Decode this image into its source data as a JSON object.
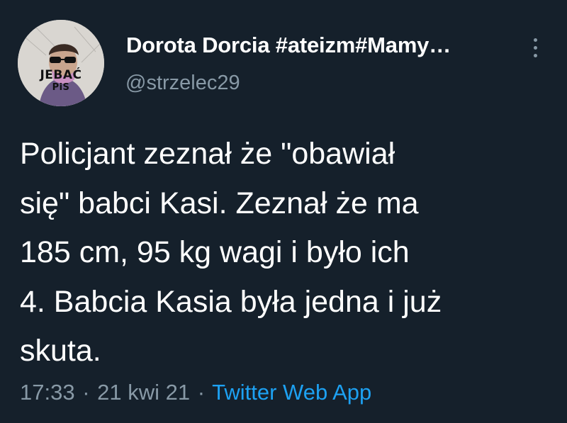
{
  "tweet": {
    "display_name": "Dorota Dorcia #ateizm#Mamy…",
    "handle": "@strzelec29",
    "avatar": {
      "text_line1": "JEBAĆ",
      "text_line2": "PiS"
    },
    "more_icon": "more-vertical-icon",
    "text_lines": [
      "Policjant zeznał że \"obawiał",
      "się\" babci Kasi. Zeznał że ma",
      "185 cm, 95 kg wagi i było ich",
      "4. Babcia Kasia była jedna i już",
      "skuta."
    ],
    "time": "17:33",
    "separator": "·",
    "date": "21 kwi 21",
    "source": "Twitter Web App"
  },
  "colors": {
    "background": "#15202b",
    "primary_text": "#ffffff",
    "secondary_text": "#8899a6",
    "link": "#1da1f2"
  }
}
